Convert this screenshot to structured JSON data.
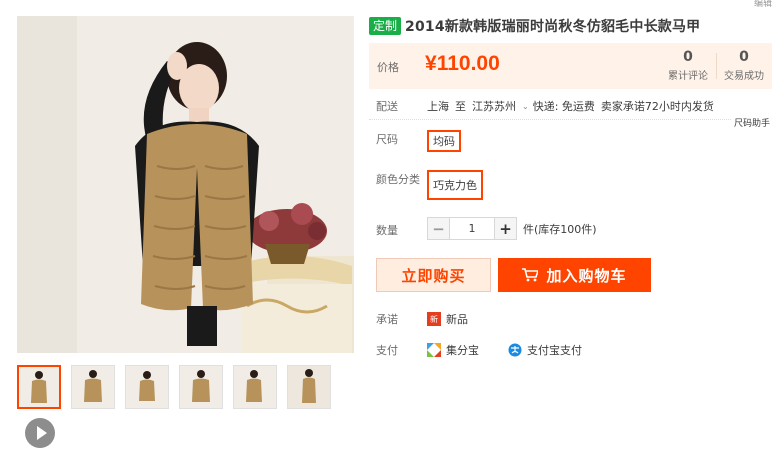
{
  "corner_label": "编辑",
  "product": {
    "badge": "定制",
    "title": "2014新款韩版瑞丽时尚秋冬仿貂毛中长款马甲"
  },
  "price": {
    "label": "价格",
    "currency_symbol": "¥",
    "amount": "110.00",
    "stats": [
      {
        "value": "0",
        "label": "累计评论"
      },
      {
        "value": "0",
        "label": "交易成功"
      }
    ]
  },
  "shipping": {
    "label": "配送",
    "from": "上海",
    "to_word": "至",
    "destination": "江苏苏州",
    "express": "快递: 免运费",
    "promise": "卖家承诺72小时内发货"
  },
  "size_helper": "尺码助手",
  "options": {
    "size_label": "尺码",
    "size_value": "均码",
    "color_label": "颜色分类",
    "color_value": "巧克力色"
  },
  "quantity": {
    "label": "数量",
    "minus": "−",
    "value": "1",
    "plus": "+",
    "stock": "件(库存100件)"
  },
  "actions": {
    "buy_now": "立即购买",
    "add_to_cart": "加入购物车"
  },
  "promise": {
    "label": "承诺",
    "icon_text": "新",
    "item": "新品"
  },
  "payment": {
    "label": "支付",
    "methods": [
      "集分宝",
      "支付宝支付"
    ]
  },
  "colors": {
    "accent": "#ff4400",
    "badge_green": "#1aae48",
    "price_bg": "#fff2e8"
  },
  "icons": [
    "play-icon",
    "cart-icon",
    "new-product-icon",
    "jifenbao-icon",
    "alipay-icon"
  ]
}
